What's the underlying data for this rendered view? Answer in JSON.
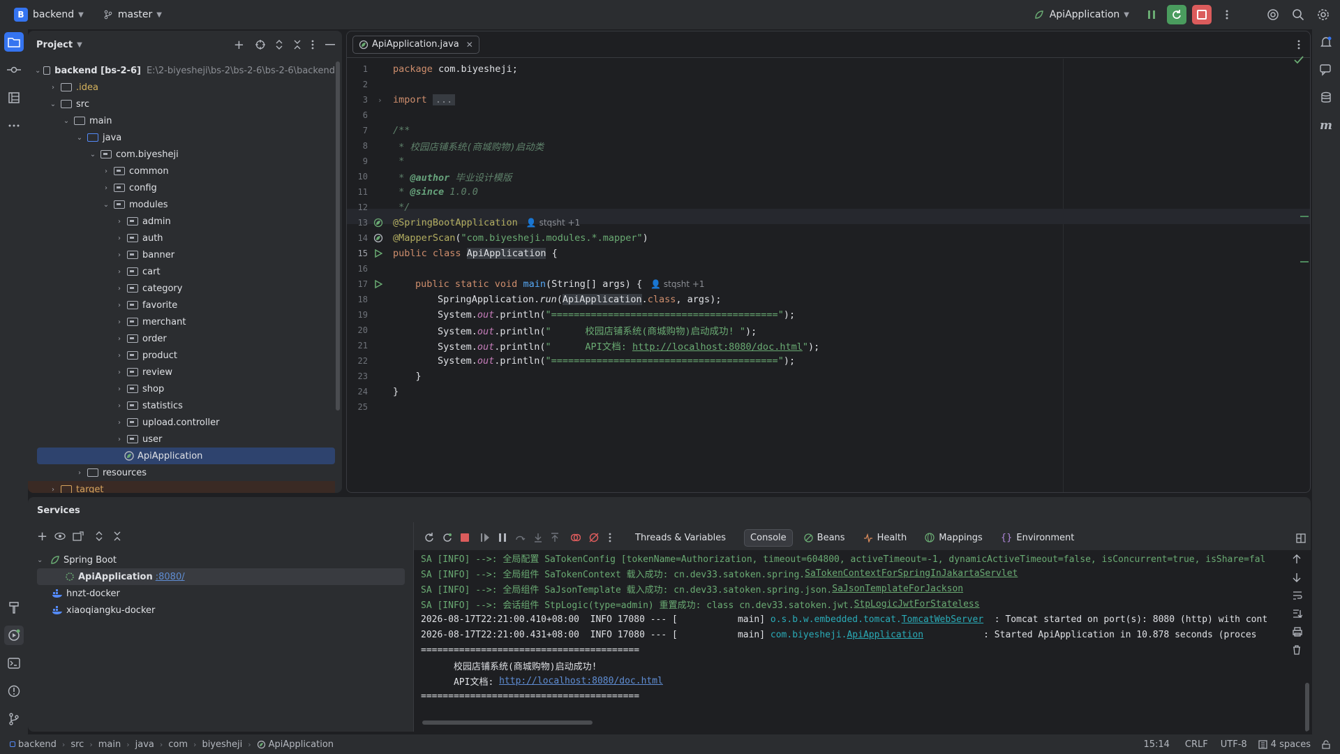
{
  "titlebar": {
    "project_badge": "B",
    "project_name": "backend",
    "branch": "master",
    "run_config": "ApiApplication"
  },
  "project_panel": {
    "title": "Project",
    "tree": [
      {
        "label": "backend [bs-2-6]",
        "sub": "E:\\2-biyesheji\\bs-2\\bs-2-6\\bs-2-6\\backend"
      },
      {
        "label": ".idea"
      },
      {
        "label": "src"
      },
      {
        "label": "main"
      },
      {
        "label": "java"
      },
      {
        "label": "com.biyesheji"
      },
      {
        "label": "common"
      },
      {
        "label": "config"
      },
      {
        "label": "modules"
      },
      {
        "label": "admin"
      },
      {
        "label": "auth"
      },
      {
        "label": "banner"
      },
      {
        "label": "cart"
      },
      {
        "label": "category"
      },
      {
        "label": "favorite"
      },
      {
        "label": "merchant"
      },
      {
        "label": "order"
      },
      {
        "label": "product"
      },
      {
        "label": "review"
      },
      {
        "label": "shop"
      },
      {
        "label": "statistics"
      },
      {
        "label": "upload.controller"
      },
      {
        "label": "user"
      },
      {
        "label": "ApiApplication"
      },
      {
        "label": "resources"
      },
      {
        "label": "target"
      }
    ]
  },
  "editor": {
    "tab_label": "ApiApplication.java",
    "line_numbers": [
      "1",
      "2",
      "3",
      "6",
      "7",
      "8",
      "9",
      "10",
      "11",
      "12",
      "13",
      "14",
      "15",
      "16",
      "17",
      "18",
      "19",
      "20",
      "21",
      "22",
      "23",
      "24",
      "25"
    ],
    "lines": {
      "l1_kw": "package",
      "l1_rest": " com.biyesheji;",
      "l3_kw": "import",
      "l3_fold": "...",
      "l7": "/**",
      "l8": " * 校园店铺系统(商城购物)启动类",
      "l9": " *",
      "l10_star": " * ",
      "l10_tag": "@author",
      "l10_val": " 毕业设计模版",
      "l11_star": " * ",
      "l11_tag": "@since",
      "l11_val": " 1.0.0",
      "l12": " */",
      "l13_ann": "@SpringBootApplication",
      "l14_ann": "@MapperScan",
      "l14_open": "(",
      "l14_str": "\"com.biyesheji.modules.*.mapper\"",
      "l14_close": ")",
      "l15_kw": "public class ",
      "l15_cls": "ApiApplication",
      "l15_rest": " {",
      "l17_kw": "public static void ",
      "l17_fn": "main",
      "l17_rest": "(String[] args) {",
      "l18_a": "SpringApplication.",
      "l18_run": "run",
      "l18_b": "(",
      "l18_cls": "ApiApplication",
      "l18_c": ".",
      "l18_kw": "class",
      "l18_d": ", args);",
      "sys": "System.",
      "out": "out",
      "println": ".println(",
      "l19_str": "\"========================================\"",
      "close": ");",
      "l20_str": "\"      校园店铺系统(商城购物)启动成功! \"",
      "l21_str_a": "\"      API文档: ",
      "l21_url": "http://localhost:8080/doc.html",
      "l21_str_b": "\"",
      "l22_str": "\"========================================\"",
      "l23": "    }",
      "l24": "}"
    },
    "inlay_author": "stqsht +1"
  },
  "services": {
    "title": "Services",
    "tree": {
      "root": "Spring Boot",
      "app": "ApiApplication",
      "app_port": ":8080/",
      "docker1": "hnzt-docker",
      "docker2": "xiaoqiangku-docker"
    },
    "tabs": [
      "Threads & Variables",
      "Console",
      "Beans",
      "Health",
      "Mappings",
      "Environment"
    ],
    "console": {
      "l1": "SA [INFO] -->: 全局配置 SaTokenConfig [tokenName=Authorization, timeout=604800, activeTimeout=-1, dynamicActiveTimeout=false, isConcurrent=true, isShare=fal",
      "l2a": "SA [INFO] -->: 全局组件 SaTokenContext 载入成功: cn.dev33.satoken.spring.",
      "l2b": "SaTokenContextForSpringInJakartaServlet",
      "l3a": "SA [INFO] -->: 全局组件 SaJsonTemplate 载入成功: cn.dev33.satoken.spring.json.",
      "l3b": "SaJsonTemplateForJackson",
      "l4a": "SA [INFO] -->: 会话组件 StpLogic(type=admin) 重置成功: class cn.dev33.satoken.jwt.",
      "l4b": "StpLogicJwtForStateless",
      "l5a": "2026-08-17T22:21:00.410+08:00  INFO 17080 --- [           main] ",
      "l5b": "o.s.b.w.embedded.tomcat.",
      "l5c": "TomcatWebServer",
      "l5d": "  : Tomcat started on port(s): 8080 (http) with cont",
      "l6a": "2026-08-17T22:21:00.431+08:00  INFO 17080 --- [           main] ",
      "l6b": "com.biyesheji.",
      "l6c": "ApiApplication",
      "l6d": "           : Started ApiApplication in 10.878 seconds (proces",
      "l7": "========================================",
      "l8": "      校园店铺系统(商城购物)启动成功!",
      "l9a": "      API文档: ",
      "l9b": "http://localhost:8080/doc.html",
      "l10": "========================================"
    }
  },
  "statusbar": {
    "crumbs": [
      "backend",
      "src",
      "main",
      "java",
      "com",
      "biyesheji",
      "ApiApplication"
    ],
    "position": "15:14",
    "line_sep": "CRLF",
    "encoding": "UTF-8",
    "indent": "4 spaces"
  },
  "colors": {
    "accent": "#3574f0",
    "run_green": "#4a9c5e",
    "stop_red": "#db5c5c",
    "selection": "#2e436e"
  }
}
